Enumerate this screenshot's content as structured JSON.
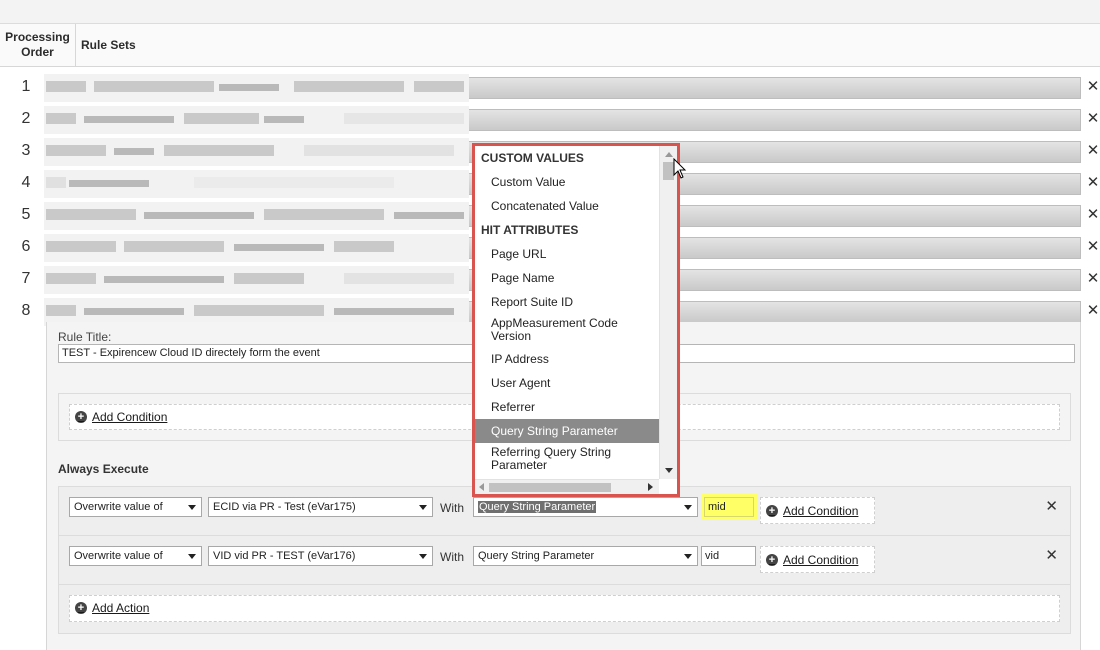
{
  "table_header": {
    "order_line1": "Processing",
    "order_line2": "Order",
    "rule_sets": "Rule Sets"
  },
  "rows": [
    "1",
    "2",
    "3",
    "4",
    "5",
    "6",
    "7",
    "8"
  ],
  "rule": {
    "title_label": "Rule Title:",
    "title_value": "TEST - Expirencew Cloud ID directely form the event",
    "add_condition": "Add Condition",
    "always_execute": "Always Execute",
    "add_action": "Add Action",
    "actions": [
      {
        "operation": "Overwrite value of",
        "variable": "ECID via PR - Test (eVar175)",
        "with_label": "With",
        "source": "Query String Parameter",
        "value": "mid",
        "add_condition": "Add Condition"
      },
      {
        "operation": "Overwrite value of",
        "variable": "VID vid PR - TEST (eVar176)",
        "with_label": "With",
        "source": "Query String Parameter",
        "value": "vid",
        "add_condition": "Add Condition"
      }
    ]
  },
  "dropdown": {
    "groups": [
      {
        "header": "CUSTOM VALUES",
        "items": [
          "Custom Value",
          "Concatenated Value"
        ]
      },
      {
        "header": "HIT ATTRIBUTES",
        "items": [
          "Page URL",
          "Page Name",
          "Report Suite ID",
          "AppMeasurement Code Version",
          "IP Address",
          "User Agent",
          "Referrer",
          "Query String Parameter",
          "Referring Query String Parameter"
        ]
      }
    ],
    "selected": "Query String Parameter",
    "border_color": "#d9534f"
  },
  "colors": {
    "highlight_yellow": "#ffff66",
    "selected_item_bg": "#8a8a8a"
  },
  "icons": {
    "row_close": "close-icon",
    "add": "plus-circle-icon",
    "select_caret": "chevron-down-icon",
    "cursor": "mouse-pointer-icon"
  }
}
